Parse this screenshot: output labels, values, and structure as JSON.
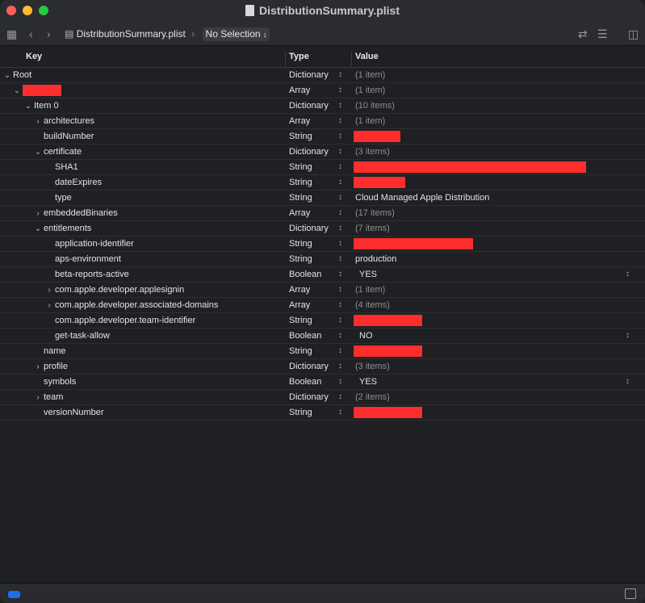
{
  "window": {
    "title": "DistributionSummary.plist"
  },
  "toolbar": {
    "jump_file": "DistributionSummary.plist",
    "jump_selection": "No Selection"
  },
  "columns": {
    "key": "Key",
    "type": "Type",
    "value": "Value"
  },
  "rows": [
    {
      "key": "Root",
      "type": "Dictionary",
      "value": "(1 item)",
      "disclosure": "expanded",
      "redacted": false,
      "kind": "muted"
    },
    {
      "key": "",
      "type": "Array",
      "value": "(1 item)",
      "disclosure": "expanded",
      "redacted_key": true,
      "kind": "muted"
    },
    {
      "key": "Item 0",
      "type": "Dictionary",
      "value": "(10 items)",
      "disclosure": "expanded",
      "kind": "muted"
    },
    {
      "key": "architectures",
      "type": "Array",
      "value": "(1 item)",
      "disclosure": "collapsed",
      "kind": "muted"
    },
    {
      "key": "buildNumber",
      "type": "String",
      "value": "",
      "redacted": true,
      "kind": "text"
    },
    {
      "key": "certificate",
      "type": "Dictionary",
      "value": "(3 items)",
      "disclosure": "expanded",
      "kind": "muted"
    },
    {
      "key": "SHA1",
      "type": "String",
      "value": "",
      "redacted": true,
      "kind": "text"
    },
    {
      "key": "dateExpires",
      "type": "String",
      "value": "",
      "redacted": true,
      "kind": "text"
    },
    {
      "key": "type",
      "type": "String",
      "value": "Cloud Managed Apple Distribution",
      "kind": "text"
    },
    {
      "key": "embeddedBinaries",
      "type": "Array",
      "value": "(17 items)",
      "disclosure": "collapsed",
      "kind": "muted"
    },
    {
      "key": "entitlements",
      "type": "Dictionary",
      "value": "(7 items)",
      "disclosure": "expanded",
      "kind": "muted"
    },
    {
      "key": "application-identifier",
      "type": "String",
      "value": "",
      "redacted": true,
      "kind": "text"
    },
    {
      "key": "aps-environment",
      "type": "String",
      "value": "production",
      "kind": "text"
    },
    {
      "key": "beta-reports-active",
      "type": "Boolean",
      "value": "YES",
      "kind": "bool"
    },
    {
      "key": "com.apple.developer.applesignin",
      "type": "Array",
      "value": "(1 item)",
      "disclosure": "collapsed",
      "kind": "muted"
    },
    {
      "key": "com.apple.developer.associated-domains",
      "type": "Array",
      "value": "(4 items)",
      "disclosure": "collapsed",
      "kind": "muted"
    },
    {
      "key": "com.apple.developer.team-identifier",
      "type": "String",
      "value": "",
      "redacted": true,
      "kind": "text"
    },
    {
      "key": "get-task-allow",
      "type": "Boolean",
      "value": "NO",
      "kind": "bool"
    },
    {
      "key": "name",
      "type": "String",
      "value": "",
      "redacted": true,
      "kind": "text"
    },
    {
      "key": "profile",
      "type": "Dictionary",
      "value": "(3 items)",
      "disclosure": "collapsed",
      "kind": "muted"
    },
    {
      "key": "symbols",
      "type": "Boolean",
      "value": "YES",
      "kind": "bool"
    },
    {
      "key": "team",
      "type": "Dictionary",
      "value": "(2 items)",
      "disclosure": "collapsed",
      "kind": "muted"
    },
    {
      "key": "versionNumber",
      "type": "String",
      "value": "",
      "redacted": true,
      "kind": "text"
    }
  ],
  "colors": {
    "background": "#1f2023",
    "redaction": "#ff2d2d",
    "accent": "#1f6feb"
  }
}
